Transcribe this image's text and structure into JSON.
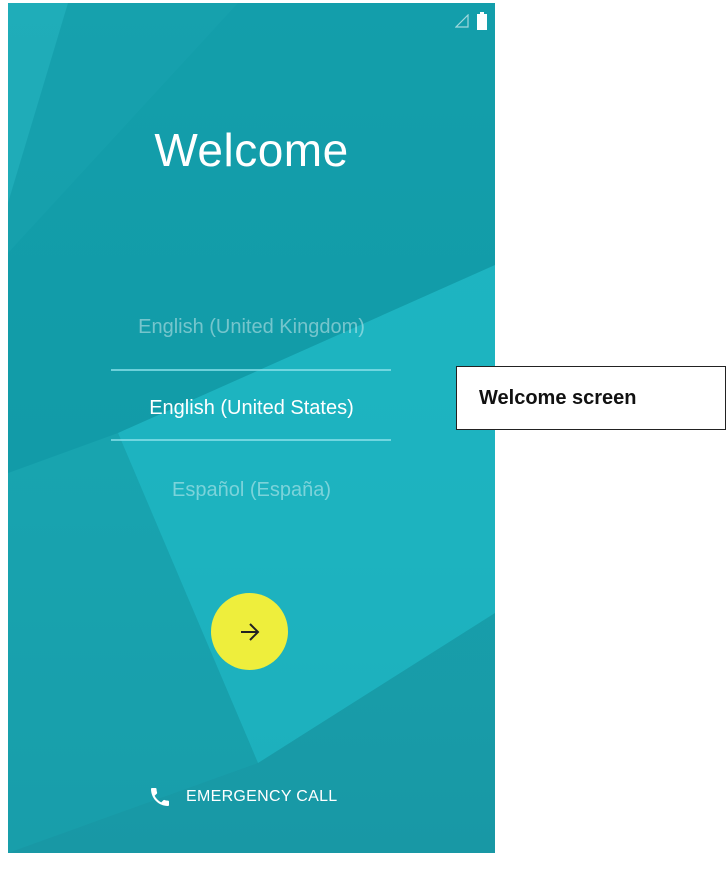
{
  "screen": {
    "title": "Welcome",
    "languages": [
      {
        "label": "English (United Kingdom)",
        "state": "unselected"
      },
      {
        "label": "English (United States)",
        "state": "selected"
      },
      {
        "label": "Español (España)",
        "state": "unselected"
      }
    ],
    "next_icon": "arrow-right-icon",
    "emergency_label": "EMERGENCY CALL",
    "emergency_icon": "phone-icon"
  },
  "status_bar": {
    "icons": [
      "signal-icon",
      "battery-icon"
    ]
  },
  "annotation": {
    "label": "Welcome screen"
  },
  "colors": {
    "background": "#1aa7b3",
    "next_button": "#eeee3c",
    "divider": "#8ce1eb"
  }
}
